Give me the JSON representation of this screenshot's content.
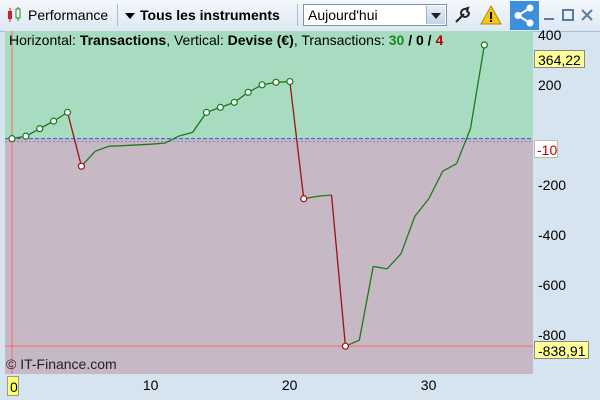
{
  "toolbar": {
    "performance_label": "Performance",
    "instruments_label": "Tous les instruments",
    "period_value": "Aujourd'hui",
    "icons": [
      "candlestick-icon",
      "settings-wrench-icon",
      "warning-icon",
      "share-icon",
      "minimize-icon",
      "maximize-icon",
      "close-icon"
    ]
  },
  "legend": {
    "horizontal_prefix": "Horizontal: ",
    "horizontal_value": "Transactions",
    "vertical_prefix": ", Vertical: ",
    "vertical_value": "Devise (€)",
    "transactions_prefix": ", Transactions: ",
    "count_total": "30",
    "sep1": " / ",
    "count_neutral": "0",
    "sep2": " / ",
    "count_loss": "4"
  },
  "copyright": "© IT-Finance.com",
  "tags": {
    "current": "364,22",
    "zero_line": "-10",
    "min": "-838,91",
    "cursor_x": "0"
  },
  "colors": {
    "positive_fill": "#a8dcc1",
    "negative_fill": "#c6b9c5",
    "gain_line": "#1a7a1a",
    "loss_line": "#a01010",
    "zero_line": "#3355dd",
    "toolbar_accent": "#3e8fdc"
  },
  "chart_data": {
    "type": "line",
    "xlabel": "",
    "ylabel": "",
    "xlim": [
      -0.5,
      37.5
    ],
    "ylim": [
      -950,
      420
    ],
    "x_ticks": [
      10,
      20,
      30
    ],
    "y_ticks": [
      400,
      200,
      -200,
      -400,
      -600,
      -800
    ],
    "y_tick_labels": [
      "400",
      "200",
      "-200",
      "-400",
      "-600",
      "-800"
    ],
    "baseline": -10,
    "series": [
      {
        "x": [
          0,
          1,
          2,
          3,
          4,
          5,
          6,
          7,
          8,
          9,
          10,
          11,
          12,
          13,
          14,
          15,
          16,
          17,
          18,
          19,
          20,
          21,
          22,
          23,
          24,
          25,
          26,
          27,
          28,
          29,
          30,
          31,
          32,
          33,
          34
        ],
        "y": [
          -10,
          0,
          30,
          60,
          95,
          -120,
          -60,
          -40,
          -38,
          -35,
          -32,
          -28,
          0,
          15,
          95,
          115,
          135,
          175,
          205,
          215,
          218,
          -250,
          -240,
          -235,
          -838.91,
          -815,
          -520,
          -530,
          -470,
          -320,
          -250,
          -140,
          -110,
          30,
          364.22
        ],
        "marked": [
          0,
          1,
          2,
          3,
          4,
          5,
          14,
          15,
          16,
          17,
          18,
          19,
          20,
          21,
          24,
          34
        ],
        "segment_colors": [
          "g",
          "g",
          "g",
          "g",
          "r",
          "g",
          "g",
          "g",
          "g",
          "g",
          "g",
          "g",
          "g",
          "g",
          "g",
          "g",
          "g",
          "g",
          "g",
          "g",
          "r",
          "g",
          "g",
          "r",
          "g",
          "g",
          "g",
          "g",
          "g",
          "g",
          "g",
          "g",
          "g",
          "g"
        ]
      }
    ]
  }
}
